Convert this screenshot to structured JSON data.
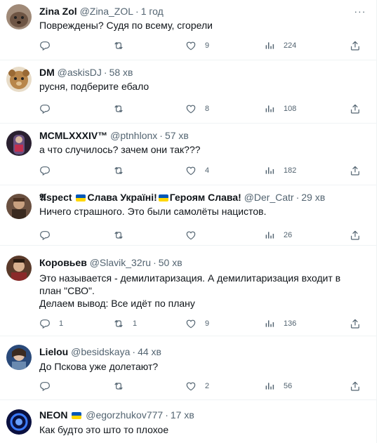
{
  "tweets": [
    {
      "name": "Zina Zol",
      "handle": "@Zina_ZOL",
      "time": "1 год",
      "text": "Повреждены? Судя по всему, сгорели",
      "replies": "",
      "retweets": "",
      "likes": "9",
      "views": "224",
      "avatar_color": "#8a7060"
    },
    {
      "name": "DM",
      "handle": "@askisDJ",
      "time": "58 хв",
      "text": "русня, подберите ебало",
      "replies": "",
      "retweets": "",
      "likes": "8",
      "views": "108",
      "avatar_color": "#b8864b"
    },
    {
      "name": "MCMLXXXIV™",
      "handle": "@ptnhlonx",
      "time": "57 хв",
      "text": "а что случилось? зачем они так???",
      "replies": "",
      "retweets": "",
      "likes": "4",
      "views": "182",
      "avatar_color": "#4a3a5a"
    },
    {
      "name_prefix": "𝕬spect",
      "name_middle": "Слава Україні!",
      "name_suffix": "Героям Слава!",
      "handle": "@Der_Catr",
      "time": "29 хв",
      "text": "Ничего страшного. Это были самолёты нацистов.",
      "replies": "",
      "retweets": "",
      "likes": "",
      "views": "26",
      "avatar_color": "#5a4030"
    },
    {
      "name": "Коровьев",
      "handle": "@Slavik_32ru",
      "time": "50 хв",
      "text": "Это называется - демилитаризация. А демилитаризация входит в план \"СВО\".\nДелаем вывод: Все идёт по плану",
      "replies": "1",
      "retweets": "1",
      "likes": "9",
      "views": "136",
      "avatar_color": "#7a5a3a"
    },
    {
      "name": "Lielou",
      "handle": "@besidskaya",
      "time": "44 хв",
      "text": "До Пскова уже долетают?",
      "replies": "",
      "retweets": "",
      "likes": "2",
      "views": "56",
      "avatar_color": "#3a5a8a"
    },
    {
      "name": "NEON",
      "handle": "@egorzhukov777",
      "time": "17 хв",
      "text": "Как будто это што то плохое",
      "replies": "",
      "retweets": "",
      "likes": "",
      "views": "",
      "avatar_color": "#1a2a6a"
    }
  ],
  "colors": {
    "text": "#0f1419",
    "secondary": "#536471",
    "border": "#eff3f4",
    "flag_blue": "#0057b7",
    "flag_yellow": "#ffd700"
  },
  "icons": [
    "reply-icon",
    "retweet-icon",
    "like-icon",
    "views-icon",
    "share-icon",
    "more-icon"
  ]
}
